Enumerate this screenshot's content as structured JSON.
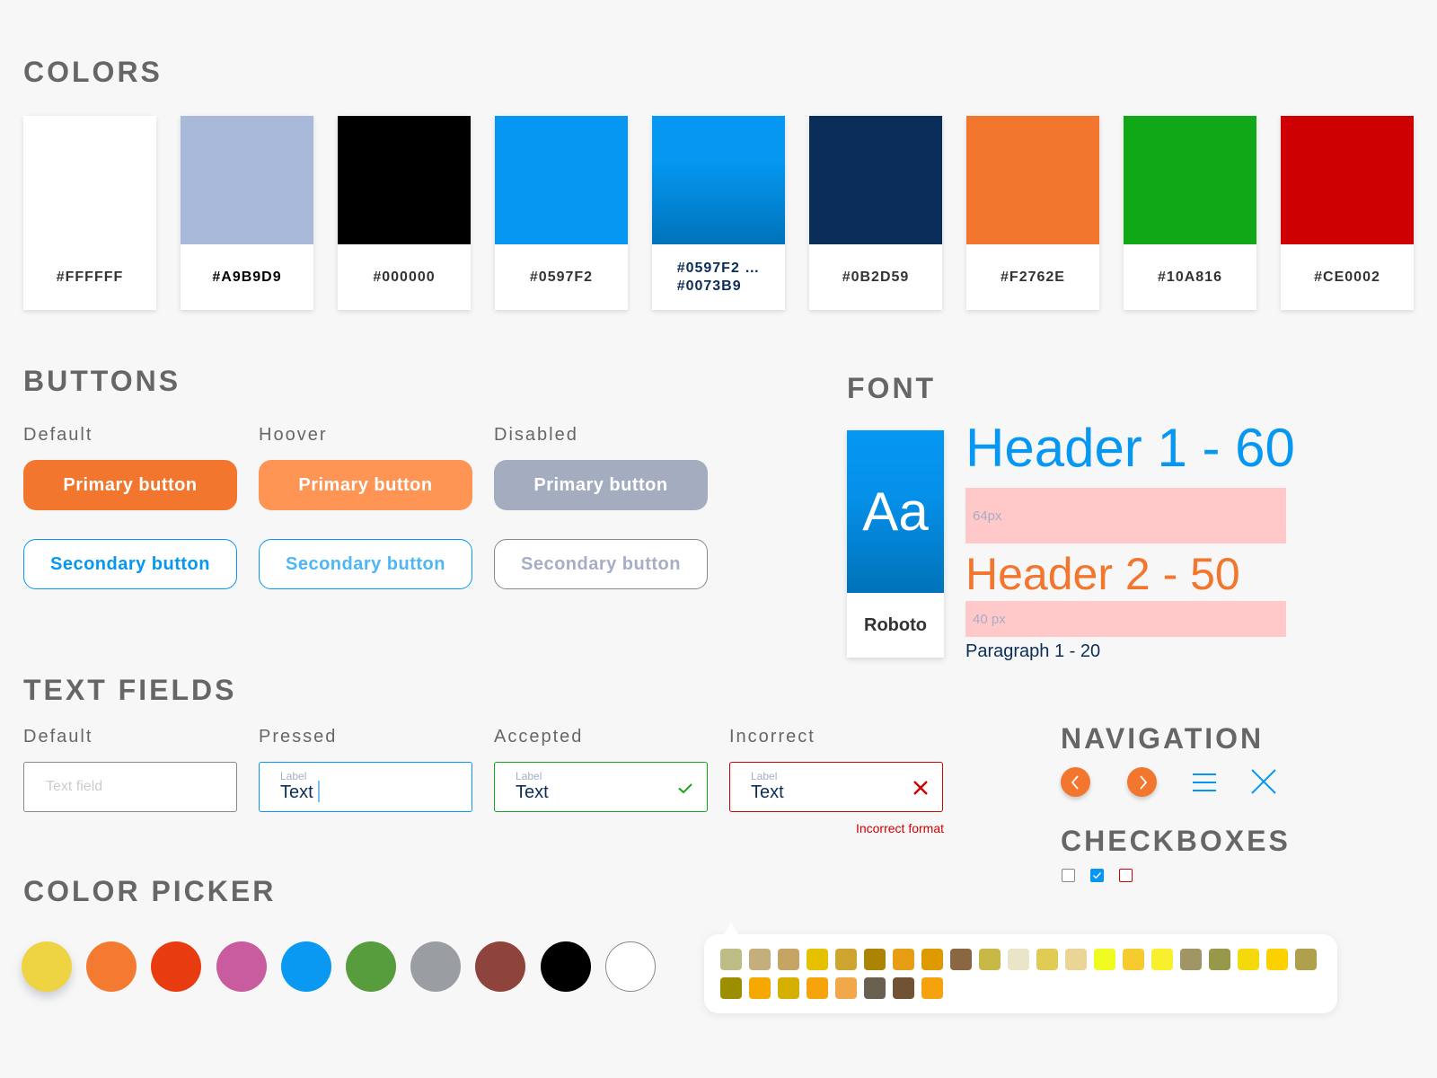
{
  "colors": {
    "title": "COLORS",
    "swatches": [
      {
        "code": "#FFFFFF",
        "fill": "#FFFFFF"
      },
      {
        "code": "#A9B9D9",
        "fill": "#A9B9D9"
      },
      {
        "code": "#000000",
        "fill": "#000000"
      },
      {
        "code": "#0597F2",
        "fill": "#0597F2"
      },
      {
        "code_line1": "#0597F2 …",
        "code_line2": "#0073B9",
        "fill_from": "#0597F2",
        "fill_to": "#0073B9"
      },
      {
        "code": "#0B2D59",
        "fill": "#0B2D59"
      },
      {
        "code": "#F2762E",
        "fill": "#F2762E"
      },
      {
        "code": "#10A816",
        "fill": "#10A816"
      },
      {
        "code": "#CE0002",
        "fill": "#CE0002"
      }
    ]
  },
  "buttons": {
    "title": "BUTTONS",
    "states": [
      "Default",
      "Hoover",
      "Disabled"
    ],
    "primary_label": "Primary button",
    "secondary_label": "Secondary button",
    "primary_colors": [
      "#F2762E",
      "#FF9555",
      "#A4ACC0"
    ],
    "secondary_colors": [
      "#0597F2",
      "#4DB6F7",
      "#A7ADC5"
    ],
    "secondary_borders": [
      "#0597F2",
      "#0597F2",
      "#888888"
    ]
  },
  "font": {
    "title": "FONT",
    "sample": "Aa",
    "family": "Roboto",
    "h1": "Header 1 - 60",
    "h1_spacing": "64px",
    "h2": "Header 2 - 50",
    "h2_spacing": "40 px",
    "paragraph": "Paragraph 1 - 20"
  },
  "text_fields": {
    "title": "TEXT FIELDS",
    "states": [
      "Default",
      "Pressed",
      "Accepted",
      "Incorrect"
    ],
    "placeholder": "Text field",
    "label": "Label",
    "value": "Text",
    "error_message": "Incorrect format",
    "border_colors": [
      "#888888",
      "#0597F2",
      "#10A816",
      "#CE0002"
    ]
  },
  "navigation": {
    "title": "NAVIGATION",
    "icons": [
      "chevron-left",
      "chevron-right",
      "menu",
      "close"
    ]
  },
  "checkboxes": {
    "title": "CHECKBOXES",
    "items": [
      {
        "state": "unchecked",
        "checked": false
      },
      {
        "state": "checked",
        "checked": true
      },
      {
        "state": "error",
        "checked": false
      }
    ]
  },
  "color_picker": {
    "title": "COLOR PICKER",
    "selected_index": 0,
    "dots": [
      "#EED442",
      "#F47A31",
      "#E83C10",
      "#C95C9E",
      "#0A99F2",
      "#579C3D",
      "#9A9DA1",
      "#8E443C",
      "#000000",
      "#FFFFFF"
    ],
    "palette_row1": [
      "#BFBD86",
      "#C4AE7B",
      "#C6A466",
      "#E6C100",
      "#CFA532",
      "#AB8305",
      "#E79E15",
      "#DD9B00",
      "#8A6642",
      "#C8B845",
      "#EAE4C8",
      "#E0CB55",
      "#EBD596",
      "#EFFB20",
      "#F6CB30",
      "#F8F02C",
      "#A29565",
      "#98984B",
      "#F4DA0D",
      "#FDD100",
      "#AEA04D"
    ],
    "palette_row2": [
      "#9D8E00",
      "#F5A800",
      "#D6B000",
      "#F5A40B",
      "#F0A84B",
      "#6A604F",
      "#715235",
      "#F5A30C"
    ]
  }
}
